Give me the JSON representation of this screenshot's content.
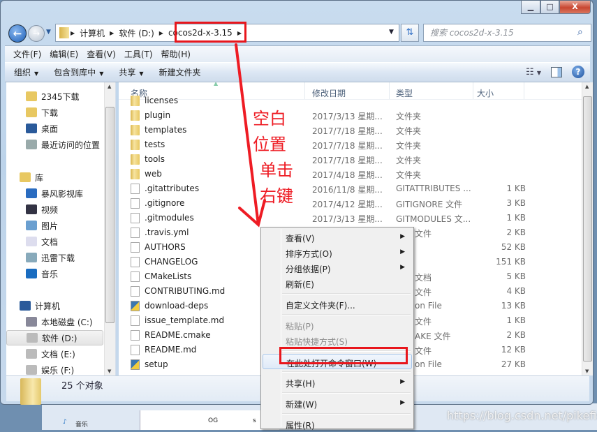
{
  "window": {
    "controls": {
      "minimize": "▁",
      "maximize": "□",
      "close": "X"
    }
  },
  "address": {
    "segments": [
      "计算机",
      "软件 (D:)",
      "cocos2d-x-3.15"
    ]
  },
  "search": {
    "placeholder": "搜索 cocos2d-x-3.15"
  },
  "menubar": [
    "文件(F)",
    "编辑(E)",
    "查看(V)",
    "工具(T)",
    "帮助(H)"
  ],
  "toolbar": {
    "organize": "组织",
    "include_library": "包含到库中",
    "share": "共享",
    "new_folder": "新建文件夹"
  },
  "sidebar": {
    "items": [
      {
        "label": "2345下载",
        "icon": "folder-icon"
      },
      {
        "label": "下载",
        "icon": "downloads-icon"
      },
      {
        "label": "桌面",
        "icon": "desktop-icon"
      },
      {
        "label": "最近访问的位置",
        "icon": "recent-places-icon"
      },
      {
        "label": "库",
        "icon": "library-icon",
        "group": true
      },
      {
        "label": "暴风影视库",
        "icon": "video-library-icon"
      },
      {
        "label": "视频",
        "icon": "videos-icon"
      },
      {
        "label": "图片",
        "icon": "pictures-icon"
      },
      {
        "label": "文档",
        "icon": "documents-icon"
      },
      {
        "label": "迅雷下载",
        "icon": "thunder-download-icon"
      },
      {
        "label": "音乐",
        "icon": "music-icon"
      },
      {
        "label": "计算机",
        "icon": "computer-icon",
        "group": true
      },
      {
        "label": "本地磁盘 (C:)",
        "icon": "system-drive-icon"
      },
      {
        "label": "软件 (D:)",
        "icon": "drive-icon",
        "selected": true
      },
      {
        "label": "文档 (E:)",
        "icon": "drive-icon"
      },
      {
        "label": "娱乐 (F:)",
        "icon": "drive-icon"
      }
    ]
  },
  "list": {
    "columns": {
      "name": "名称",
      "date": "修改日期",
      "type": "类型",
      "size": "大小"
    },
    "rows": [
      {
        "name": "licenses",
        "kind": "folder"
      },
      {
        "name": "plugin",
        "date": "2017/3/13 星期...",
        "type": "文件夹",
        "kind": "folder"
      },
      {
        "name": "templates",
        "date": "2017/7/18 星期...",
        "type": "文件夹",
        "kind": "folder"
      },
      {
        "name": "tests",
        "date": "2017/7/18 星期...",
        "type": "文件夹",
        "kind": "folder"
      },
      {
        "name": "tools",
        "date": "2017/7/18 星期...",
        "type": "文件夹",
        "kind": "folder"
      },
      {
        "name": "web",
        "date": "2017/4/18 星期...",
        "type": "文件夹",
        "kind": "folder"
      },
      {
        "name": ".gitattributes",
        "date": "2016/11/8 星期...",
        "type": "GITATTRIBUTES ...",
        "size": "1 KB",
        "kind": "file"
      },
      {
        "name": ".gitignore",
        "date": "2017/4/12 星期...",
        "type": "GITIGNORE 文件",
        "size": "3 KB",
        "kind": "file"
      },
      {
        "name": ".gitmodules",
        "date": "2017/3/13 星期...",
        "type": "GITMODULES 文...",
        "size": "1 KB",
        "kind": "file"
      },
      {
        "name": ".travis.yml",
        "type_partial": "文件",
        "size": "2 KB",
        "kind": "file"
      },
      {
        "name": "AUTHORS",
        "size": "52 KB",
        "kind": "file"
      },
      {
        "name": "CHANGELOG",
        "size": "151 KB",
        "kind": "file"
      },
      {
        "name": "CMakeLists",
        "type_partial": "文档",
        "size": "5 KB",
        "kind": "text"
      },
      {
        "name": "CONTRIBUTING.md",
        "type_partial": "文件",
        "size": "4 KB",
        "kind": "file"
      },
      {
        "name": "download-deps",
        "type_partial": "on File",
        "size": "13 KB",
        "kind": "python"
      },
      {
        "name": "issue_template.md",
        "type_partial": "文件",
        "size": "1 KB",
        "kind": "file"
      },
      {
        "name": "README.cmake",
        "type_partial": "AKE 文件",
        "size": "2 KB",
        "kind": "file"
      },
      {
        "name": "README.md",
        "type_partial": "文件",
        "size": "12 KB",
        "kind": "file"
      },
      {
        "name": "setup",
        "type_partial": "on File",
        "size": "27 KB",
        "kind": "python"
      }
    ]
  },
  "status": {
    "count": "25 个对象"
  },
  "context_menu": {
    "items": [
      {
        "label": "查看(V)",
        "submenu": true
      },
      {
        "label": "排序方式(O)",
        "submenu": true
      },
      {
        "label": "分组依据(P)",
        "submenu": true
      },
      {
        "label": "刷新(E)"
      },
      {
        "sep": true
      },
      {
        "label": "自定义文件夹(F)..."
      },
      {
        "sep": true
      },
      {
        "label": "粘贴(P)",
        "disabled": true
      },
      {
        "label": "粘贴快捷方式(S)",
        "disabled": true
      },
      {
        "sep": true
      },
      {
        "label": "在此处打开命令窗口(W)",
        "highlighted": true
      },
      {
        "sep": true
      },
      {
        "label": "共享(H)",
        "submenu": true
      },
      {
        "sep": true
      },
      {
        "label": "新建(W)",
        "submenu": true
      },
      {
        "sep": true
      },
      {
        "label": "属性(R)"
      }
    ]
  },
  "annotation": {
    "lines": [
      "空白",
      "位置",
      "单击",
      "右键"
    ],
    "color": "#ee1c24"
  },
  "background_window": {
    "items": [
      "音乐",
      "OG",
      "s"
    ]
  },
  "watermark": "https://blog.csdn.net/pikefish"
}
